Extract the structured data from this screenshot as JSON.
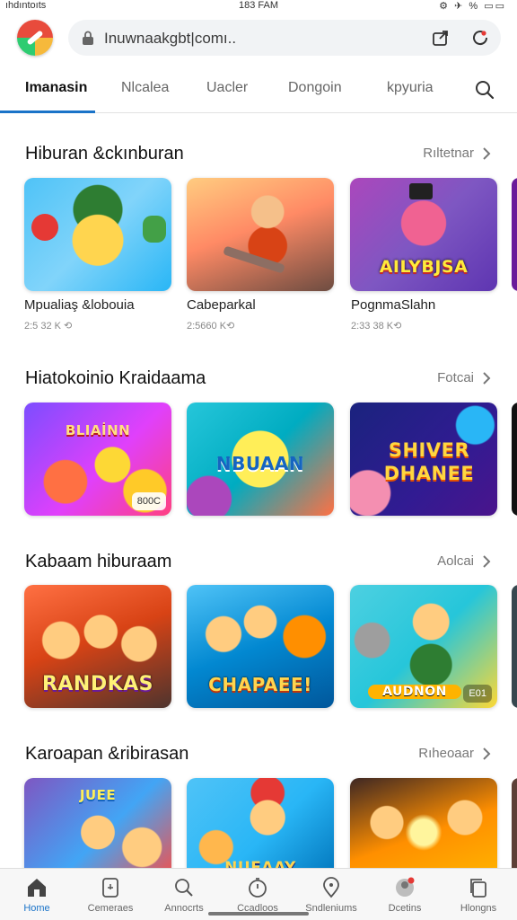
{
  "status": {
    "left": "ıhdıntoıts",
    "time": "183 FAM",
    "right": "⚙ ✈ % ▭▭"
  },
  "browser": {
    "url": "Inuwnaakgbt|comı..",
    "accent": "#1a73c8"
  },
  "tabs": [
    {
      "label": "Imanasin"
    },
    {
      "label": "Nlcalea"
    },
    {
      "label": "Uacler"
    },
    {
      "label": "Dongoin"
    },
    {
      "label": "kpyuria"
    }
  ],
  "sections": [
    {
      "title": "Hiburan &ckınburan",
      "more": "Rıltetnar",
      "cards": [
        {
          "art": "",
          "title": "Mpualiaş &lobouia",
          "meta": "2:5 32 K ⟲"
        },
        {
          "art": "",
          "title": "Cabeparkal",
          "meta": "2:5660 K⟲"
        },
        {
          "art": "AILYBJSA",
          "title": "PognmaSlahn",
          "meta": "2:33 38 K⟲"
        }
      ]
    },
    {
      "title": "Hiatokoinio Kraidaama",
      "more": "Fotcai",
      "cards": [
        {
          "art": "BLIAİNN",
          "badge": "800C"
        },
        {
          "art": "NBUAAN"
        },
        {
          "art": "SHIVER DHANEE"
        }
      ]
    },
    {
      "title": "Kabaam hiburaam",
      "more": "Aolcai",
      "cards": [
        {
          "art": "RANDKAS"
        },
        {
          "art": "CHAPAEE!"
        },
        {
          "art": "AUDNON",
          "badge": "E01"
        }
      ]
    },
    {
      "title": "Karoapan &ribirasan",
      "more": "Rıheoaar",
      "cards": [
        {
          "art": "JUEE"
        },
        {
          "art": "NUEAAY"
        },
        {
          "art": ""
        }
      ]
    }
  ],
  "bottom_nav": [
    {
      "label": "Home",
      "icon": "home-icon"
    },
    {
      "label": "Cemeraes",
      "icon": "phone-icon"
    },
    {
      "label": "Annocrts",
      "icon": "search-icon"
    },
    {
      "label": "Ccadloos",
      "icon": "timer-icon"
    },
    {
      "label": "Sndleniums",
      "icon": "pin-icon"
    },
    {
      "label": "Dcetins",
      "icon": "avatar-icon"
    },
    {
      "label": "Hlongns",
      "icon": "copy-icon"
    }
  ]
}
